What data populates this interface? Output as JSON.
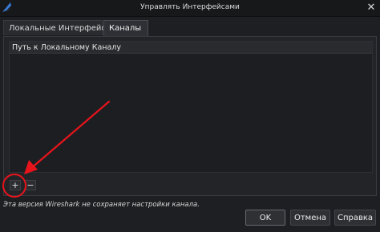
{
  "window": {
    "title": "Управлять Интерфейсами",
    "close_glyph": "✕",
    "icon": "wireshark-fin-icon"
  },
  "tabs": [
    {
      "label": "Локальные Интерфейсы",
      "selected": false
    },
    {
      "label": "Каналы",
      "selected": true
    }
  ],
  "list": {
    "column_header": "Путь к Локальному Каналу",
    "rows": []
  },
  "controls": {
    "add_label": "+",
    "remove_label": "−"
  },
  "status": {
    "text": "Эта версия Wireshark не сохраняет настройки канала."
  },
  "buttons": {
    "ok": "OK",
    "cancel": "Отмена",
    "help": "Справка"
  },
  "annotation": {
    "color": "#e8141c"
  },
  "colors": {
    "background": "#1e1f22",
    "accent_blue": "#3a7bd5"
  }
}
